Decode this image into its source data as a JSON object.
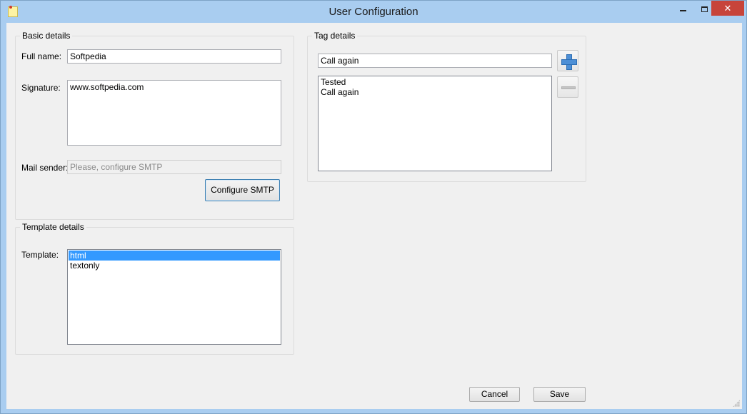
{
  "window": {
    "title": "User Configuration"
  },
  "basic_details": {
    "legend": "Basic details",
    "full_name_label": "Full name:",
    "full_name_value": "Softpedia",
    "signature_label": "Signature:",
    "signature_value": "www.softpedia.com",
    "mail_sender_label": "Mail sender:",
    "mail_sender_placeholder": "Please, configure SMTP",
    "configure_smtp_label": "Configure SMTP"
  },
  "template_details": {
    "legend": "Template details",
    "template_label": "Template:",
    "items": [
      "html",
      "textonly"
    ],
    "selected": "html"
  },
  "tag_details": {
    "legend": "Tag details",
    "tag_input_value": "Call again",
    "items": [
      "Tested",
      "Call again"
    ]
  },
  "footer": {
    "cancel_label": "Cancel",
    "save_label": "Save"
  },
  "icons": {
    "app": "sticky-note-icon",
    "add": "plus-icon",
    "remove": "minus-icon"
  }
}
